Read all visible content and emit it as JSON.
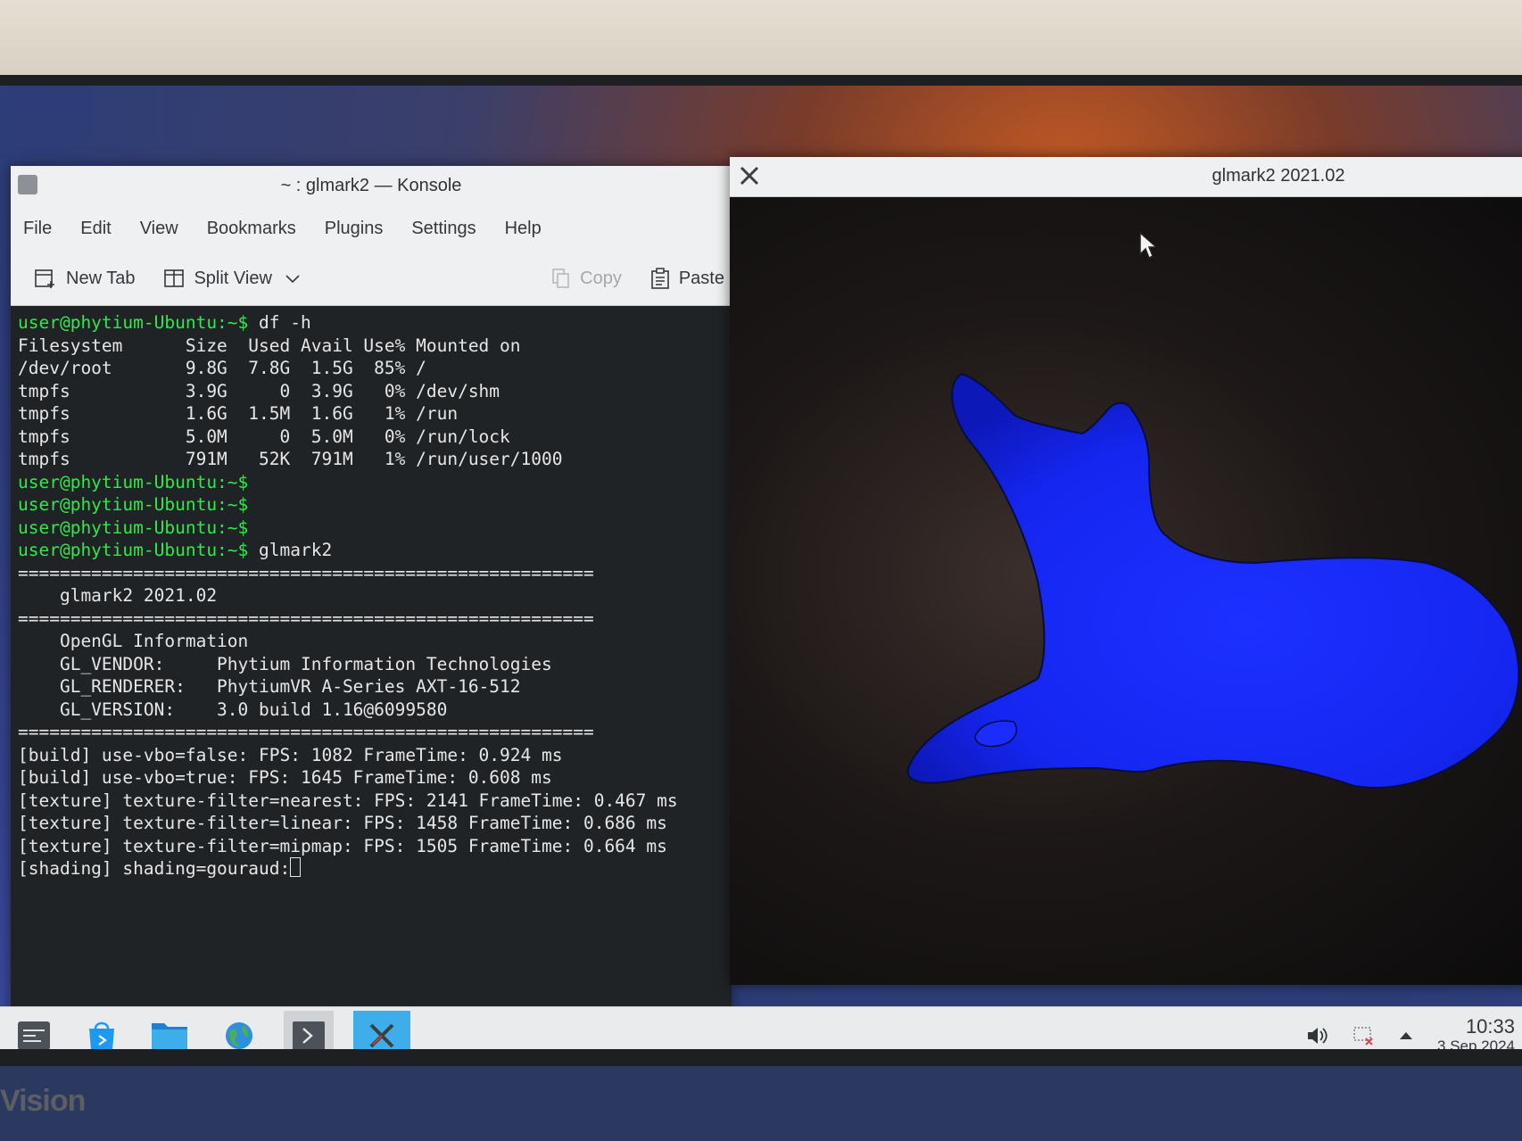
{
  "konsole": {
    "title": "~ : glmark2 — Konsole",
    "menu": [
      "File",
      "Edit",
      "View",
      "Bookmarks",
      "Plugins",
      "Settings",
      "Help"
    ],
    "toolbar": {
      "new_tab": "New Tab",
      "split_view": "Split View",
      "copy": "Copy",
      "paste": "Paste"
    },
    "terminal": {
      "prompt": "user@phytium-Ubuntu:~$",
      "prompt_user": "user@phytium-Ubuntu",
      "prompt_sep": ":",
      "prompt_path": "~",
      "prompt_sign": "$",
      "cmd_df": " df -h",
      "df_header": "Filesystem      Size  Used Avail Use% Mounted on",
      "df_rows": [
        "/dev/root       9.8G  7.8G  1.5G  85% /",
        "tmpfs           3.9G     0  3.9G   0% /dev/shm",
        "tmpfs           1.6G  1.5M  1.6G   1% /run",
        "tmpfs           5.0M     0  5.0M   0% /run/lock",
        "tmpfs           791M   52K  791M   1% /run/user/1000"
      ],
      "cmd_glmark": " glmark2",
      "separator": "=======================================================",
      "glmark_title": "    glmark2 2021.02",
      "opengl_heading": "    OpenGL Information",
      "gl_vendor": "    GL_VENDOR:     Phytium Information Technologies",
      "gl_renderer": "    GL_RENDERER:   PhytiumVR A-Series AXT-16-512",
      "gl_version": "    GL_VERSION:    3.0 build 1.16@6099580",
      "results": [
        "[build] use-vbo=false: FPS: 1082 FrameTime: 0.924 ms",
        "[build] use-vbo=true: FPS: 1645 FrameTime: 0.608 ms",
        "[texture] texture-filter=nearest: FPS: 2141 FrameTime: 0.467 ms",
        "[texture] texture-filter=linear: FPS: 1458 FrameTime: 0.686 ms",
        "[texture] texture-filter=mipmap: FPS: 1505 FrameTime: 0.664 ms"
      ],
      "current": "[shading] shading=gouraud:"
    }
  },
  "glmark": {
    "title": "glmark2 2021.02",
    "model_color": "#1a2cff"
  },
  "taskbar": {
    "apps": [
      "app-launcher-icon",
      "discover-icon",
      "file-manager-icon",
      "browser-icon",
      "terminal-icon",
      "glmark-x-icon"
    ],
    "active_app": "glmark-x-icon",
    "clock_time": "10:33",
    "clock_date": "3 Sep 2024"
  },
  "monitor": {
    "brand": "Vision"
  }
}
